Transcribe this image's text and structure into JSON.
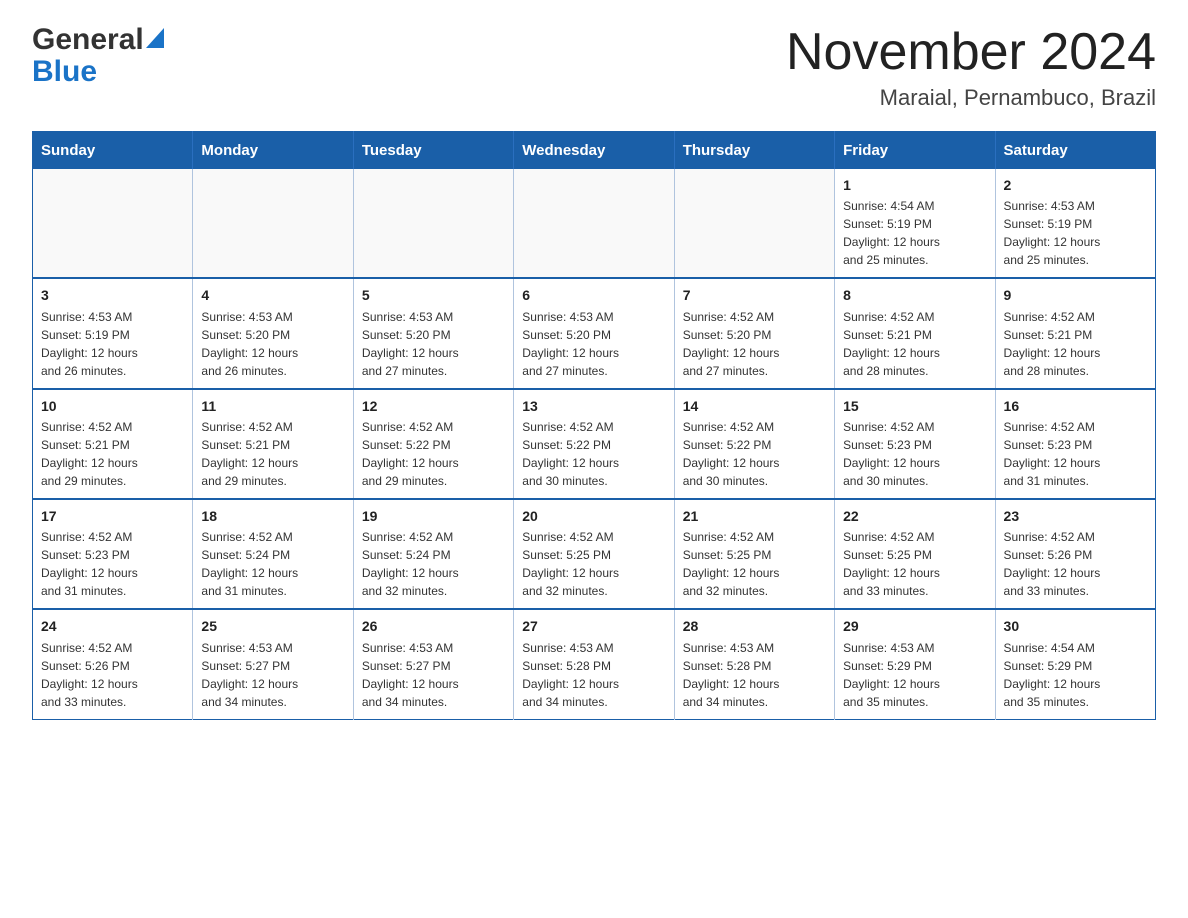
{
  "header": {
    "logo_general": "General",
    "logo_blue": "Blue",
    "month_title": "November 2024",
    "location": "Maraial, Pernambuco, Brazil"
  },
  "weekdays": [
    "Sunday",
    "Monday",
    "Tuesday",
    "Wednesday",
    "Thursday",
    "Friday",
    "Saturday"
  ],
  "weeks": [
    [
      {
        "day": "",
        "info": ""
      },
      {
        "day": "",
        "info": ""
      },
      {
        "day": "",
        "info": ""
      },
      {
        "day": "",
        "info": ""
      },
      {
        "day": "",
        "info": ""
      },
      {
        "day": "1",
        "info": "Sunrise: 4:54 AM\nSunset: 5:19 PM\nDaylight: 12 hours\nand 25 minutes."
      },
      {
        "day": "2",
        "info": "Sunrise: 4:53 AM\nSunset: 5:19 PM\nDaylight: 12 hours\nand 25 minutes."
      }
    ],
    [
      {
        "day": "3",
        "info": "Sunrise: 4:53 AM\nSunset: 5:19 PM\nDaylight: 12 hours\nand 26 minutes."
      },
      {
        "day": "4",
        "info": "Sunrise: 4:53 AM\nSunset: 5:20 PM\nDaylight: 12 hours\nand 26 minutes."
      },
      {
        "day": "5",
        "info": "Sunrise: 4:53 AM\nSunset: 5:20 PM\nDaylight: 12 hours\nand 27 minutes."
      },
      {
        "day": "6",
        "info": "Sunrise: 4:53 AM\nSunset: 5:20 PM\nDaylight: 12 hours\nand 27 minutes."
      },
      {
        "day": "7",
        "info": "Sunrise: 4:52 AM\nSunset: 5:20 PM\nDaylight: 12 hours\nand 27 minutes."
      },
      {
        "day": "8",
        "info": "Sunrise: 4:52 AM\nSunset: 5:21 PM\nDaylight: 12 hours\nand 28 minutes."
      },
      {
        "day": "9",
        "info": "Sunrise: 4:52 AM\nSunset: 5:21 PM\nDaylight: 12 hours\nand 28 minutes."
      }
    ],
    [
      {
        "day": "10",
        "info": "Sunrise: 4:52 AM\nSunset: 5:21 PM\nDaylight: 12 hours\nand 29 minutes."
      },
      {
        "day": "11",
        "info": "Sunrise: 4:52 AM\nSunset: 5:21 PM\nDaylight: 12 hours\nand 29 minutes."
      },
      {
        "day": "12",
        "info": "Sunrise: 4:52 AM\nSunset: 5:22 PM\nDaylight: 12 hours\nand 29 minutes."
      },
      {
        "day": "13",
        "info": "Sunrise: 4:52 AM\nSunset: 5:22 PM\nDaylight: 12 hours\nand 30 minutes."
      },
      {
        "day": "14",
        "info": "Sunrise: 4:52 AM\nSunset: 5:22 PM\nDaylight: 12 hours\nand 30 minutes."
      },
      {
        "day": "15",
        "info": "Sunrise: 4:52 AM\nSunset: 5:23 PM\nDaylight: 12 hours\nand 30 minutes."
      },
      {
        "day": "16",
        "info": "Sunrise: 4:52 AM\nSunset: 5:23 PM\nDaylight: 12 hours\nand 31 minutes."
      }
    ],
    [
      {
        "day": "17",
        "info": "Sunrise: 4:52 AM\nSunset: 5:23 PM\nDaylight: 12 hours\nand 31 minutes."
      },
      {
        "day": "18",
        "info": "Sunrise: 4:52 AM\nSunset: 5:24 PM\nDaylight: 12 hours\nand 31 minutes."
      },
      {
        "day": "19",
        "info": "Sunrise: 4:52 AM\nSunset: 5:24 PM\nDaylight: 12 hours\nand 32 minutes."
      },
      {
        "day": "20",
        "info": "Sunrise: 4:52 AM\nSunset: 5:25 PM\nDaylight: 12 hours\nand 32 minutes."
      },
      {
        "day": "21",
        "info": "Sunrise: 4:52 AM\nSunset: 5:25 PM\nDaylight: 12 hours\nand 32 minutes."
      },
      {
        "day": "22",
        "info": "Sunrise: 4:52 AM\nSunset: 5:25 PM\nDaylight: 12 hours\nand 33 minutes."
      },
      {
        "day": "23",
        "info": "Sunrise: 4:52 AM\nSunset: 5:26 PM\nDaylight: 12 hours\nand 33 minutes."
      }
    ],
    [
      {
        "day": "24",
        "info": "Sunrise: 4:52 AM\nSunset: 5:26 PM\nDaylight: 12 hours\nand 33 minutes."
      },
      {
        "day": "25",
        "info": "Sunrise: 4:53 AM\nSunset: 5:27 PM\nDaylight: 12 hours\nand 34 minutes."
      },
      {
        "day": "26",
        "info": "Sunrise: 4:53 AM\nSunset: 5:27 PM\nDaylight: 12 hours\nand 34 minutes."
      },
      {
        "day": "27",
        "info": "Sunrise: 4:53 AM\nSunset: 5:28 PM\nDaylight: 12 hours\nand 34 minutes."
      },
      {
        "day": "28",
        "info": "Sunrise: 4:53 AM\nSunset: 5:28 PM\nDaylight: 12 hours\nand 34 minutes."
      },
      {
        "day": "29",
        "info": "Sunrise: 4:53 AM\nSunset: 5:29 PM\nDaylight: 12 hours\nand 35 minutes."
      },
      {
        "day": "30",
        "info": "Sunrise: 4:54 AM\nSunset: 5:29 PM\nDaylight: 12 hours\nand 35 minutes."
      }
    ]
  ]
}
